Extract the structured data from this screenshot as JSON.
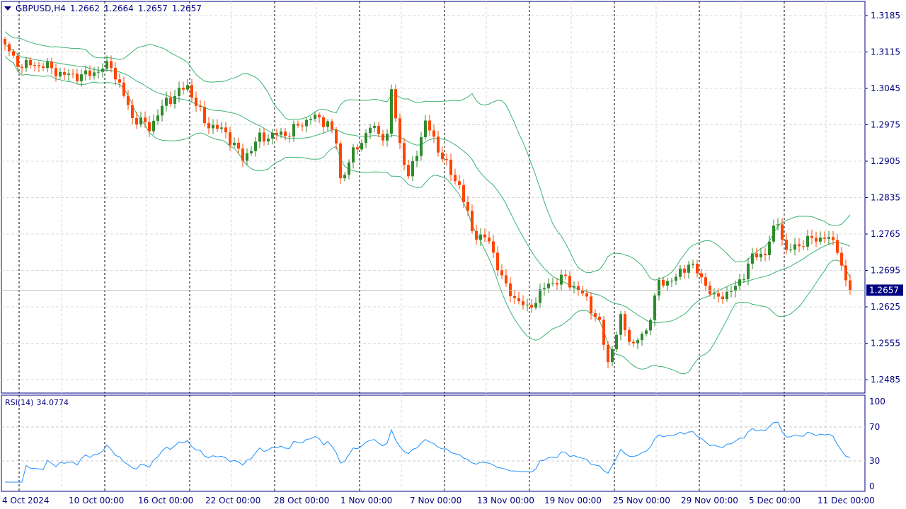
{
  "header": {
    "symbol": "GBPUSD,H4",
    "open": "1.2662",
    "high": "1.2664",
    "low": "1.2657",
    "close": "1.2657"
  },
  "rsi_header": {
    "label": "RSI(14)",
    "value": "34.0774"
  },
  "colors": {
    "bull": "#2e8b2e",
    "bear": "#ff4500",
    "bands": "#3cb371",
    "rsi": "#1e90ff",
    "axis": "#000080"
  },
  "chart_data": {
    "type": "candlestick",
    "candle_count": 200,
    "close_path": [
      [
        0,
        1.313
      ],
      [
        2,
        1.31
      ],
      [
        4,
        1.309
      ],
      [
        9,
        1.309
      ],
      [
        14,
        1.307
      ],
      [
        19,
        1.307
      ],
      [
        25,
        1.309
      ],
      [
        30,
        1.299
      ],
      [
        34,
        1.297
      ],
      [
        38,
        1.302
      ],
      [
        43,
        1.305
      ],
      [
        47,
        1.298
      ],
      [
        52,
        1.296
      ],
      [
        56,
        1.291
      ],
      [
        60,
        1.295
      ],
      [
        67,
        1.296
      ],
      [
        72,
        1.299
      ],
      [
        76,
        1.298
      ],
      [
        78,
        1.294
      ],
      [
        79,
        1.287
      ],
      [
        82,
        1.292
      ],
      [
        86,
        1.297
      ],
      [
        90,
        1.295
      ],
      [
        91,
        1.304
      ],
      [
        93,
        1.294
      ],
      [
        95,
        1.287
      ],
      [
        99,
        1.298
      ],
      [
        102,
        1.293
      ],
      [
        105,
        1.288
      ],
      [
        107,
        1.286
      ],
      [
        110,
        1.277
      ],
      [
        114,
        1.275
      ],
      [
        118,
        1.266
      ],
      [
        123,
        1.262
      ],
      [
        128,
        1.267
      ],
      [
        132,
        1.268
      ],
      [
        137,
        1.264
      ],
      [
        140,
        1.259
      ],
      [
        142,
        1.252
      ],
      [
        145,
        1.26
      ],
      [
        148,
        1.255
      ],
      [
        151,
        1.258
      ],
      [
        154,
        1.267
      ],
      [
        158,
        1.268
      ],
      [
        161,
        1.271
      ],
      [
        165,
        1.267
      ],
      [
        167,
        1.264
      ],
      [
        172,
        1.266
      ],
      [
        176,
        1.272
      ],
      [
        179,
        1.273
      ],
      [
        182,
        1.279
      ],
      [
        184,
        1.273
      ],
      [
        188,
        1.275
      ],
      [
        193,
        1.276
      ],
      [
        196,
        1.274
      ],
      [
        198,
        1.267
      ],
      [
        199,
        1.2657
      ]
    ],
    "y_axis": {
      "ticks": [
        "1.3185",
        "1.3115",
        "1.3045",
        "1.2975",
        "1.2905",
        "1.2835",
        "1.2765",
        "1.2695",
        "1.2625",
        "1.2555",
        "1.2485"
      ],
      "range": [
        1.2485,
        1.3185
      ]
    },
    "current_price": "1.2657",
    "x_axis": {
      "ticks": [
        "4 Oct 2024",
        "10 Oct 00:00",
        "16 Oct 00:00",
        "22 Oct 00:00",
        "28 Oct 00:00",
        "1 Nov 00:00",
        "7 Nov 00:00",
        "13 Nov 00:00",
        "19 Nov 00:00",
        "25 Nov 00:00",
        "29 Nov 00:00",
        "5 Dec 00:00",
        "11 Dec 00:00"
      ]
    },
    "indicators": {
      "bollinger": {
        "period": 20,
        "deviation": 2
      },
      "rsi": {
        "period": 14,
        "levels": [
          "100",
          "70",
          "30",
          "0"
        ],
        "last": 34.0774
      }
    }
  }
}
